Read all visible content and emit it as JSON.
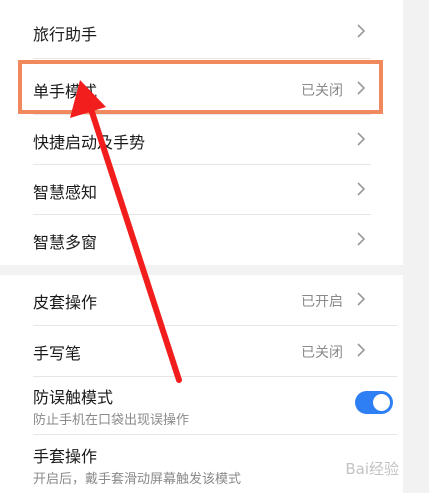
{
  "settings": {
    "travel_assistant": "旅行助手",
    "one_hand_mode": "单手模式",
    "one_hand_mode_value": "已关闭",
    "quick_launch_gestures": "快捷启动及手势",
    "smart_sense": "智慧感知",
    "smart_multiwindow": "智慧多窗",
    "case_operation": "皮套操作",
    "case_operation_value": "已开启",
    "stylus": "手写笔",
    "stylus_value": "已关闭",
    "anti_mistouch": "防误触模式",
    "anti_mistouch_desc": "防止手机在口袋出现误操作",
    "anti_mistouch_enabled": true,
    "glove_mode": "手套操作",
    "glove_mode_desc": "开启后，戴手套滑动屏幕触发该模式"
  },
  "icons": {
    "chevron": "chevron-right-icon"
  },
  "colors": {
    "toggle_on": "#2f7ff4",
    "highlight_border": "#f08a5e",
    "arrow": "#f21d1d"
  },
  "watermark": "Bai经验"
}
